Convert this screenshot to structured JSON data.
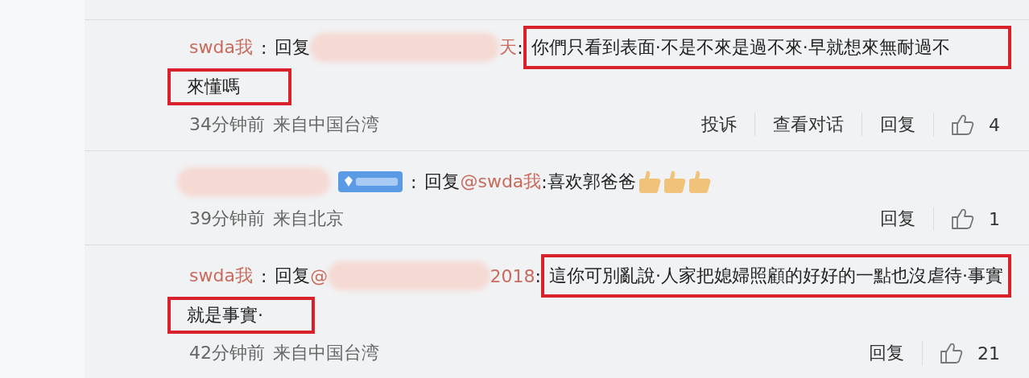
{
  "comments": [
    {
      "author": {
        "text": "swda我",
        "redacted": false
      },
      "author_separator": ":",
      "reply_label": "回复",
      "reply_to": {
        "redacted": true,
        "after": "天"
      },
      "separator": ":",
      "text": {
        "text": "你們只看到表面·不是不來是過不來·早就想來無耐過不",
        "highlighted": true
      },
      "continuation": {
        "text": "來懂嗎",
        "highlighted": true
      },
      "time": "34分钟前",
      "location": "来自中国台湾",
      "actions": [
        "投诉",
        "查看对话",
        "回复"
      ],
      "likes": "4"
    },
    {
      "author": {
        "redacted": true
      },
      "badge": true,
      "author_separator": ":",
      "reply_label": "回复",
      "reply_to": {
        "before": "@swda我",
        "redacted": false
      },
      "separator": ":",
      "text": {
        "text": "喜欢郭爸爸",
        "highlighted": false
      },
      "emojis": [
        {
          "kind": "thumbs-up"
        },
        {
          "kind": "thumbs-up"
        },
        {
          "kind": "thumbs-up"
        }
      ],
      "time": "39分钟前",
      "location": "来自北京",
      "actions": [
        "回复"
      ],
      "likes": "1"
    },
    {
      "author": {
        "text": "swda我",
        "redacted": false
      },
      "author_separator": ":",
      "reply_label": "回复",
      "reply_to": {
        "before": "@",
        "redacted": true,
        "after": "2018"
      },
      "separator": ":",
      "text": {
        "text": "這你可別亂說·人家把媳婦照顧的好好的一點也沒虐待·事實",
        "highlighted": true
      },
      "continuation": {
        "text": "就是事實·",
        "highlighted": true
      },
      "time": "42分钟前",
      "location": "来自中国台湾",
      "actions": [
        "回复"
      ],
      "likes": "21"
    }
  ]
}
